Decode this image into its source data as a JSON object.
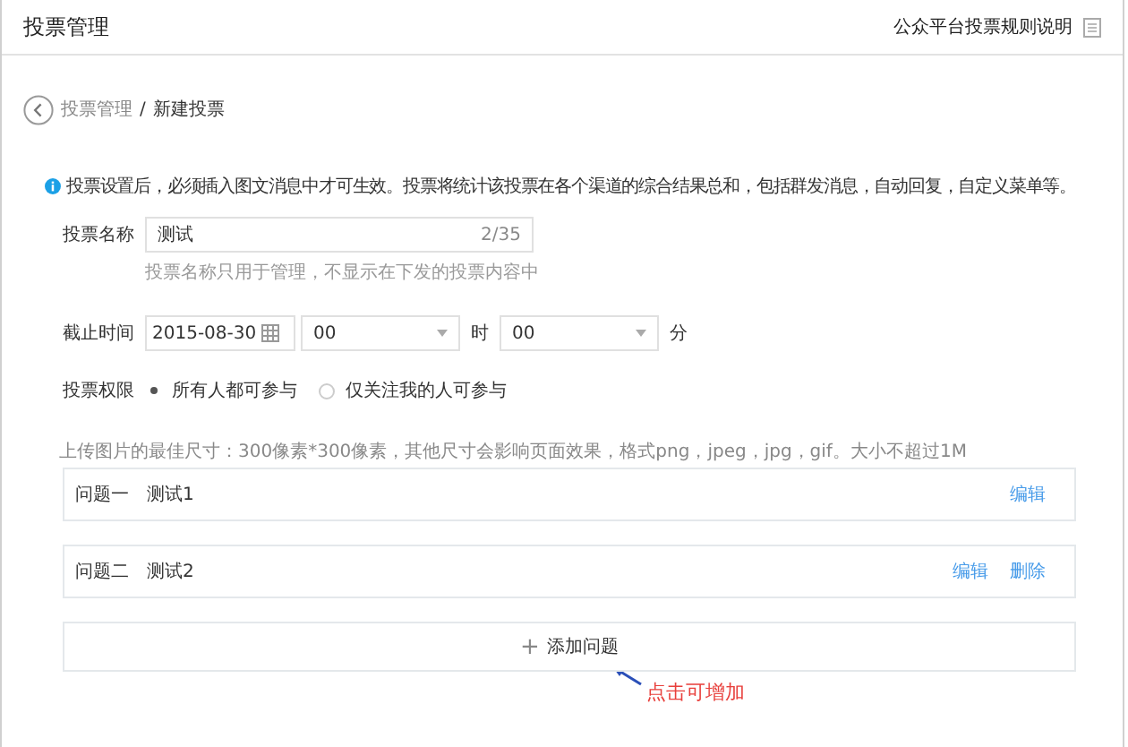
{
  "header": {
    "title": "投票管理",
    "help_link": "公众平台投票规则说明"
  },
  "breadcrumb": {
    "parent": "投票管理",
    "separator": "/",
    "current": "新建投票"
  },
  "notice": "投票设置后，必须插入图文消息中才可生效。投票将统计该投票在各个渠道的综合结果总和，包括群发消息，自动回复，自定义菜单等。",
  "name_field": {
    "label": "投票名称",
    "value": "测试",
    "counter": "2/35",
    "hint": "投票名称只用于管理，不显示在下发的投票内容中"
  },
  "deadline": {
    "label": "截止时间",
    "date": "2015-08-30",
    "hour": "00",
    "hour_unit": "时",
    "minute": "00",
    "minute_unit": "分"
  },
  "permission": {
    "label": "投票权限",
    "options": [
      {
        "label": "所有人都可参与",
        "selected": true
      },
      {
        "label": "仅关注我的人可参与",
        "selected": false
      }
    ]
  },
  "upload_note": "上传图片的最佳尺寸：300像素*300像素，其他尺寸会影响页面效果，格式png，jpeg，jpg，gif。大小不超过1M",
  "questions": [
    {
      "number": "问题一",
      "title": "测试1",
      "actions": [
        "编辑"
      ]
    },
    {
      "number": "问题二",
      "title": "测试2",
      "actions": [
        "编辑",
        "删除"
      ]
    }
  ],
  "add_button": {
    "icon": "+",
    "label": "添加问题"
  },
  "annotation": "点击可增加"
}
